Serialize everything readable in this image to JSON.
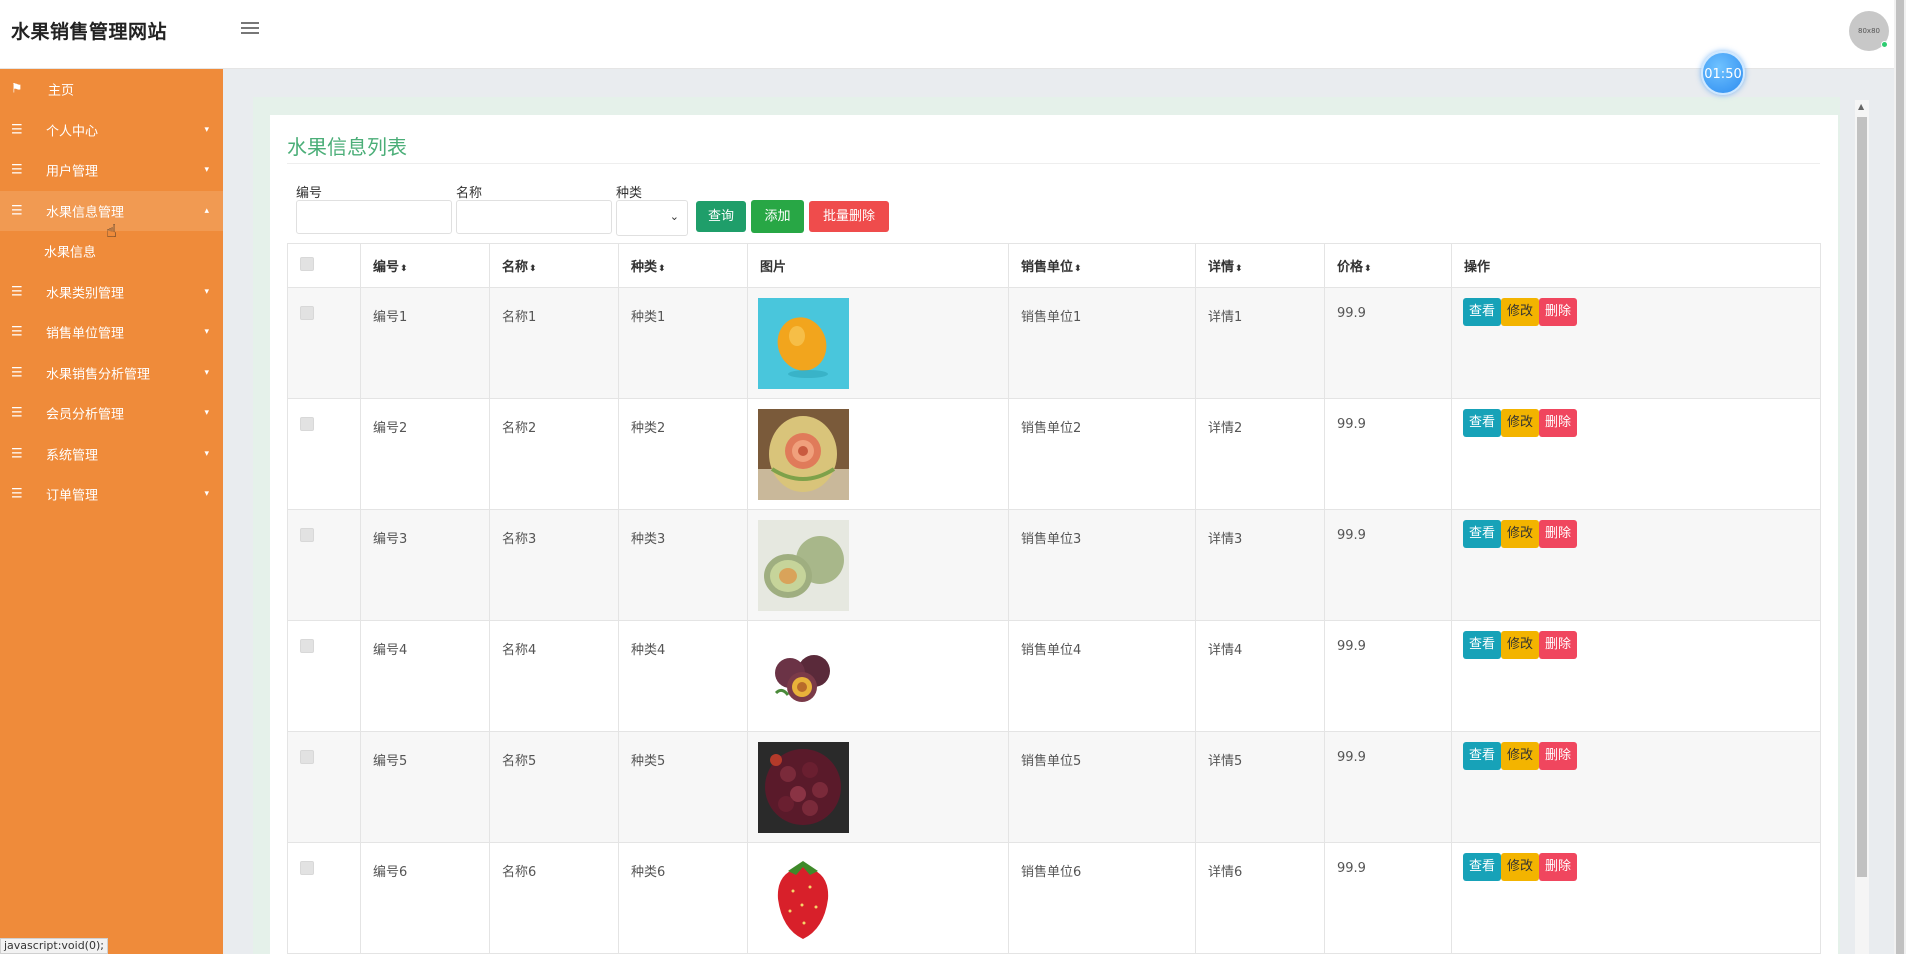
{
  "app": {
    "title": "水果销售管理网站",
    "avatar_text": "80x80",
    "timer": "01:50"
  },
  "sidebar": {
    "items": [
      {
        "label": "主页",
        "icon": "flag-icon",
        "caret": ""
      },
      {
        "label": "个人中心",
        "icon": "list-icon",
        "caret": "⌄"
      },
      {
        "label": "用户管理",
        "icon": "list-icon",
        "caret": "⌄"
      },
      {
        "label": "水果信息管理",
        "icon": "list-icon",
        "caret": "⌄"
      },
      {
        "label": "水果类别管理",
        "icon": "list-icon",
        "caret": "⌄"
      },
      {
        "label": "销售单位管理",
        "icon": "list-icon",
        "caret": "⌄"
      },
      {
        "label": "水果销售分析管理",
        "icon": "list-icon",
        "caret": "⌄"
      },
      {
        "label": "会员分析管理",
        "icon": "list-icon",
        "caret": "⌄"
      },
      {
        "label": "系统管理",
        "icon": "list-icon",
        "caret": "⌄"
      },
      {
        "label": "订单管理",
        "icon": "list-icon",
        "caret": "⌄"
      }
    ],
    "subitem": "水果信息"
  },
  "main": {
    "title": "水果信息列表",
    "search": {
      "code_label": "编号",
      "name_label": "名称",
      "type_label": "种类",
      "code_value": "",
      "name_value": "",
      "type_value": ""
    },
    "buttons": {
      "query": "查询",
      "add": "添加",
      "bulk_delete": "批量删除"
    },
    "columns": [
      "编号",
      "名称",
      "种类",
      "图片",
      "销售单位",
      "详情",
      "价格",
      "操作"
    ],
    "rows": [
      {
        "code": "编号1",
        "name": "名称1",
        "type": "种类1",
        "unit": "销售单位1",
        "detail": "详情1",
        "price": "99.9",
        "image": "lemon"
      },
      {
        "code": "编号2",
        "name": "名称2",
        "type": "种类2",
        "unit": "销售单位2",
        "detail": "详情2",
        "price": "99.9",
        "image": "carved-melon"
      },
      {
        "code": "编号3",
        "name": "名称3",
        "type": "种类3",
        "unit": "销售单位3",
        "detail": "详情3",
        "price": "99.9",
        "image": "cantaloupe"
      },
      {
        "code": "编号4",
        "name": "名称4",
        "type": "种类4",
        "unit": "销售单位4",
        "detail": "详情4",
        "price": "99.9",
        "image": "passion-fruit"
      },
      {
        "code": "编号5",
        "name": "名称5",
        "type": "种类5",
        "unit": "销售单位5",
        "detail": "详情5",
        "price": "99.9",
        "image": "mulberries"
      },
      {
        "code": "编号6",
        "name": "名称6",
        "type": "种类6",
        "unit": "销售单位6",
        "detail": "详情6",
        "price": "99.9",
        "image": "strawberry"
      }
    ],
    "row_actions": {
      "view": "查看",
      "edit": "修改",
      "delete": "删除"
    }
  },
  "status_bar": "javascript:void(0);"
}
